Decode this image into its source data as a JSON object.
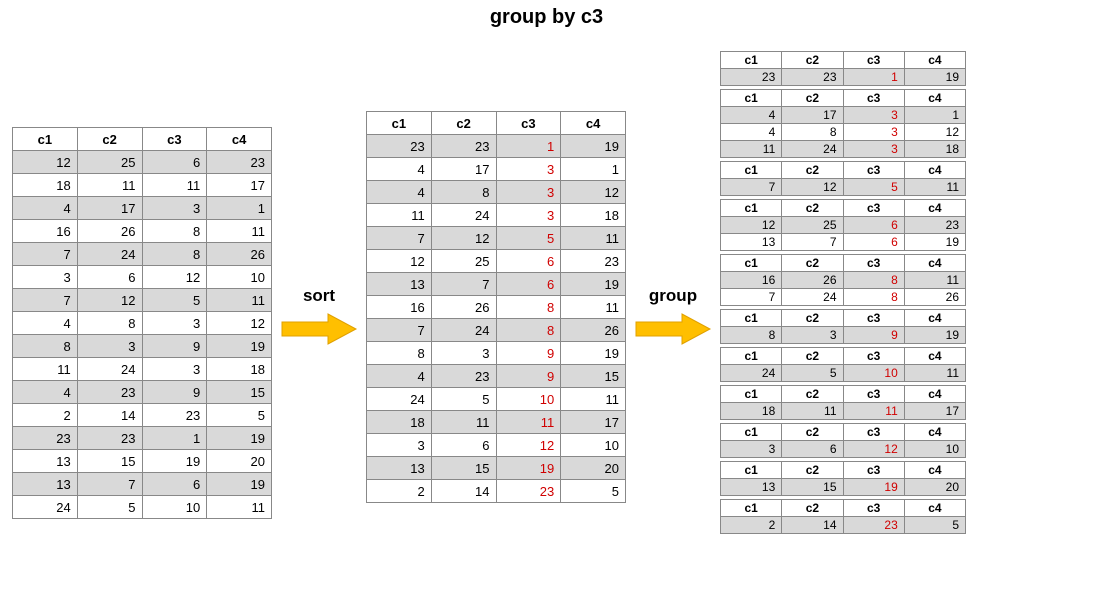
{
  "title": "group by c3",
  "arrow_sort_label": "sort",
  "arrow_group_label": "group",
  "columns": [
    "c1",
    "c2",
    "c3",
    "c4"
  ],
  "table_original": {
    "rows": [
      [
        12,
        25,
        6,
        23
      ],
      [
        18,
        11,
        11,
        17
      ],
      [
        4,
        17,
        3,
        1
      ],
      [
        16,
        26,
        8,
        11
      ],
      [
        7,
        24,
        8,
        26
      ],
      [
        3,
        6,
        12,
        10
      ],
      [
        7,
        12,
        5,
        11
      ],
      [
        4,
        8,
        3,
        12
      ],
      [
        8,
        3,
        9,
        19
      ],
      [
        11,
        24,
        3,
        18
      ],
      [
        4,
        23,
        9,
        15
      ],
      [
        2,
        14,
        23,
        5
      ],
      [
        23,
        23,
        1,
        19
      ],
      [
        13,
        15,
        19,
        20
      ],
      [
        13,
        7,
        6,
        19
      ],
      [
        24,
        5,
        10,
        11
      ]
    ]
  },
  "table_sorted": {
    "highlight_col": 2,
    "rows": [
      [
        23,
        23,
        1,
        19
      ],
      [
        4,
        17,
        3,
        1
      ],
      [
        4,
        8,
        3,
        12
      ],
      [
        11,
        24,
        3,
        18
      ],
      [
        7,
        12,
        5,
        11
      ],
      [
        12,
        25,
        6,
        23
      ],
      [
        13,
        7,
        6,
        19
      ],
      [
        16,
        26,
        8,
        11
      ],
      [
        7,
        24,
        8,
        26
      ],
      [
        8,
        3,
        9,
        19
      ],
      [
        4,
        23,
        9,
        15
      ],
      [
        24,
        5,
        10,
        11
      ],
      [
        18,
        11,
        11,
        17
      ],
      [
        3,
        6,
        12,
        10
      ],
      [
        13,
        15,
        19,
        20
      ],
      [
        2,
        14,
        23,
        5
      ]
    ]
  },
  "groups": {
    "highlight_col": 2,
    "groups": [
      {
        "rows": [
          [
            23,
            23,
            1,
            19
          ]
        ]
      },
      {
        "rows": [
          [
            4,
            17,
            3,
            1
          ],
          [
            4,
            8,
            3,
            12
          ],
          [
            11,
            24,
            3,
            18
          ]
        ]
      },
      {
        "rows": [
          [
            7,
            12,
            5,
            11
          ]
        ]
      },
      {
        "rows": [
          [
            12,
            25,
            6,
            23
          ],
          [
            13,
            7,
            6,
            19
          ]
        ]
      },
      {
        "rows": [
          [
            16,
            26,
            8,
            11
          ],
          [
            7,
            24,
            8,
            26
          ]
        ]
      },
      {
        "rows": [
          [
            8,
            3,
            9,
            19
          ]
        ]
      },
      {
        "rows": [
          [
            24,
            5,
            10,
            11
          ]
        ]
      },
      {
        "rows": [
          [
            18,
            11,
            11,
            17
          ]
        ]
      },
      {
        "rows": [
          [
            3,
            6,
            12,
            10
          ]
        ]
      },
      {
        "rows": [
          [
            13,
            15,
            19,
            20
          ]
        ]
      },
      {
        "rows": [
          [
            2,
            14,
            23,
            5
          ]
        ]
      }
    ]
  }
}
